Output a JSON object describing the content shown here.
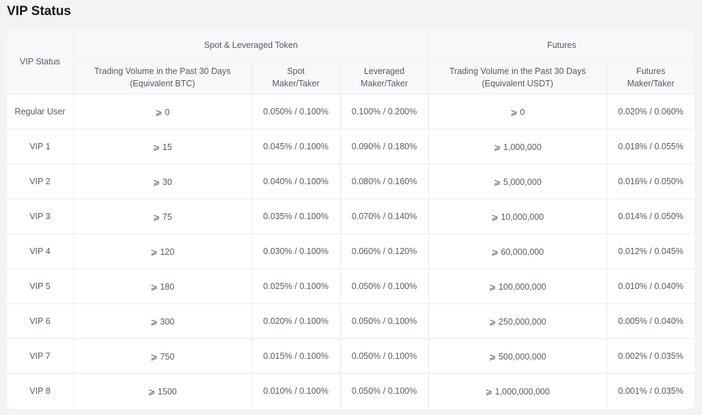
{
  "page": {
    "title": "VIP Status"
  },
  "table": {
    "group_headers": {
      "vip_status": "VIP Status",
      "spot": "Spot & Leveraged Token",
      "futures": "Futures"
    },
    "sub_headers": [
      {
        "line1": "Trading Volume in the Past 30 Days",
        "line2": "(Equivalent BTC)"
      },
      {
        "line1": "Spot",
        "line2": "Maker/Taker"
      },
      {
        "line1": "Leveraged",
        "line2": "Maker/Taker"
      },
      {
        "line1": "Trading Volume in the Past 30 Days",
        "line2": "(Equivalent USDT)"
      },
      {
        "line1": "Futures",
        "line2": "Maker/Taker"
      }
    ],
    "rows": [
      {
        "level": "Regular User",
        "spot_volume": "⩾ 0",
        "spot_fee": "0.050% / 0.100%",
        "leveraged_fee": "0.100% / 0.200%",
        "futures_volume": "⩾ 0",
        "futures_fee": "0.020% / 0.060%"
      },
      {
        "level": "VIP 1",
        "spot_volume": "⩾ 15",
        "spot_fee": "0.045% / 0.100%",
        "leveraged_fee": "0.090% / 0.180%",
        "futures_volume": "⩾ 1,000,000",
        "futures_fee": "0.018% / 0.055%"
      },
      {
        "level": "VIP 2",
        "spot_volume": "⩾ 30",
        "spot_fee": "0.040% / 0.100%",
        "leveraged_fee": "0.080% / 0.160%",
        "futures_volume": "⩾ 5,000,000",
        "futures_fee": "0.016% / 0.050%"
      },
      {
        "level": "VIP 3",
        "spot_volume": "⩾ 75",
        "spot_fee": "0.035% / 0.100%",
        "leveraged_fee": "0.070% / 0.140%",
        "futures_volume": "⩾ 10,000,000",
        "futures_fee": "0.014% / 0.050%"
      },
      {
        "level": "VIP 4",
        "spot_volume": "⩾ 120",
        "spot_fee": "0.030% / 0.100%",
        "leveraged_fee": "0.060% / 0.120%",
        "futures_volume": "⩾ 60,000,000",
        "futures_fee": "0.012% / 0.045%"
      },
      {
        "level": "VIP 5",
        "spot_volume": "⩾ 180",
        "spot_fee": "0.025% / 0.100%",
        "leveraged_fee": "0.050% / 0.100%",
        "futures_volume": "⩾ 100,000,000",
        "futures_fee": "0.010% / 0.040%"
      },
      {
        "level": "VIP 6",
        "spot_volume": "⩾ 300",
        "spot_fee": "0.020% / 0.100%",
        "leveraged_fee": "0.050% / 0.100%",
        "futures_volume": "⩾ 250,000,000",
        "futures_fee": "0.005% / 0.040%"
      },
      {
        "level": "VIP 7",
        "spot_volume": "⩾ 750",
        "spot_fee": "0.015% / 0.100%",
        "leveraged_fee": "0.050% / 0.100%",
        "futures_volume": "⩾ 500,000,000",
        "futures_fee": "0.002% / 0.035%"
      },
      {
        "level": "VIP 8",
        "spot_volume": "⩾ 1500",
        "spot_fee": "0.010% / 0.100%",
        "leveraged_fee": "0.050% / 0.100%",
        "futures_volume": "⩾ 1,000,000,000",
        "futures_fee": "0.001% / 0.035%"
      }
    ]
  }
}
